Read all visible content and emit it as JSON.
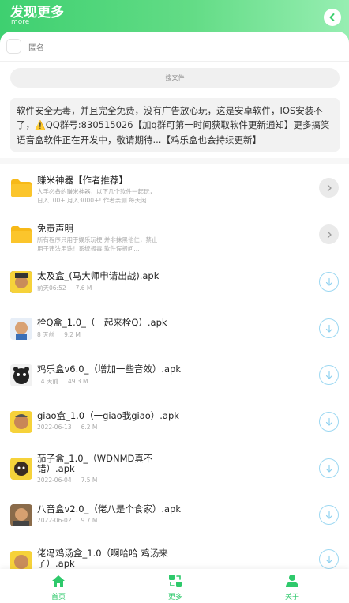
{
  "header": {
    "title": "发现更多",
    "subtitle": "more",
    "back_icon": "chevron-left-icon",
    "gradient": [
      "#3ed070",
      "#97eeb2"
    ]
  },
  "anonymous": {
    "label": "匿名",
    "checked": false
  },
  "search": {
    "button_label": "搜文件"
  },
  "notice": {
    "text_before": "软件安全无毒，并且完全免费，没有广告放心玩，这是安卓软件，IOS安装不了，",
    "warn_icon": "⚠️",
    "text_after": "QQ群号:830515026【加q群可第一时间获取软件更新通知】更多搞笑语音盒软件正在开发中，敬请期待...【鸡乐盒也会持续更新】"
  },
  "folders": [
    {
      "name": "赚米神器【作者推荐】",
      "desc_line1": "人手必备的赚米神器，以下几个软件一起玩，",
      "desc_line2": "日入100+ 月入3000+! 作者亲测 每天闲..."
    },
    {
      "name": "免责声明",
      "desc_line1": "所有程序只用于娱乐玩梗 并非抹黑他仁，禁止",
      "desc_line2": "用于违法用途！系统报毒 软件误报问..."
    }
  ],
  "files": [
    {
      "name": "太及盒_(马大师申请出战).apk",
      "date": "前天06:52",
      "size": "7.6 M"
    },
    {
      "name": "栓Q盒_1.0_（一起来栓Q）.apk",
      "date": "8 天前",
      "size": "9.2 M"
    },
    {
      "name": "鸡乐盒v6.0_（增加一些音效）.apk",
      "date": "14 天前",
      "size": "49.3 M"
    },
    {
      "name": "giao盒_1.0（一giao我giao）.apk",
      "date": "2022-06-13",
      "size": "6.2 M"
    },
    {
      "name_line1": "茄子盒_1.0_（WDNMD真不",
      "name_line2": "错）.apk",
      "date": "2022-06-04",
      "size": "7.5 M"
    },
    {
      "name": "八音盒v2.0_（佬八是个食家）.apk",
      "date": "2022-06-02",
      "size": "9.7 M"
    },
    {
      "name_line1": "佬冯鸡汤盒_1.0（啊哈哈 鸡汤来",
      "name_line2": "了）.apk"
    }
  ],
  "tabbar": {
    "accent": "#2ec96b",
    "tabs": [
      {
        "label": "首页",
        "icon": "home-icon"
      },
      {
        "label": "更多",
        "icon": "swap-icon"
      },
      {
        "label": "关于",
        "icon": "user-icon"
      }
    ]
  }
}
